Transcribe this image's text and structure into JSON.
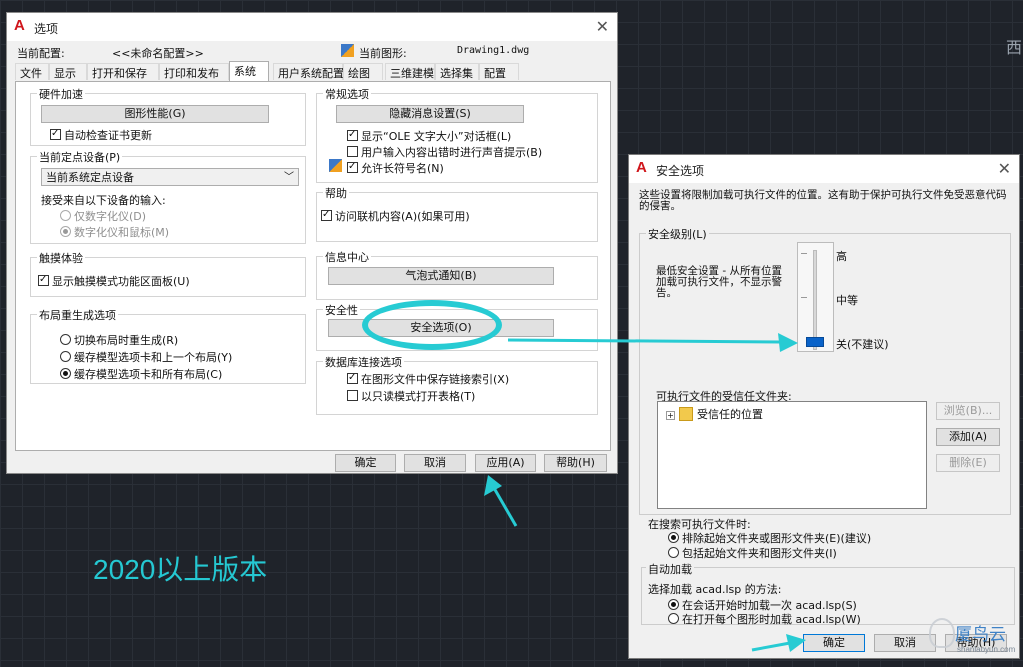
{
  "colors": {
    "accent": "#27cbd3",
    "autocad_red": "#d0161c",
    "slider_blue": "#0a63c9"
  },
  "background": {
    "edge_text": "西"
  },
  "options_dialog": {
    "title": "选项",
    "current_profile_label": "当前配置:",
    "current_profile_value": "<<未命名配置>>",
    "current_drawing_label": "当前图形:",
    "current_drawing_value": "Drawing1.dwg",
    "tabs": [
      "文件",
      "显示",
      "打开和保存",
      "打印和发布",
      "系统",
      "用户系统配置",
      "绘图",
      "三维建模",
      "选择集",
      "配置"
    ],
    "hw_accel": {
      "title": "硬件加速",
      "graphics_button": "图形性能(G)",
      "auto_check_cert": "自动检查证书更新"
    },
    "pointing_device": {
      "title": "当前定点设备(P)",
      "selected": "当前系统定点设备",
      "accept_input_label": "接受来自以下设备的输入:",
      "opt_digitizer_only": "仅数字化仪(D)",
      "opt_digitizer_mouse": "数字化仪和鼠标(M)"
    },
    "touch": {
      "title": "触摸体验",
      "show_touch_panel": "显示触摸模式功能区面板(U)"
    },
    "layout_regen": {
      "title": "布局重生成选项",
      "opt1": "切换布局时重生成(R)",
      "opt2": "缓存模型选项卡和上一个布局(Y)",
      "opt3": "缓存模型选项卡和所有布局(C)"
    },
    "general": {
      "title": "常规选项",
      "hidden_msg_button": "隐藏消息设置(S)",
      "show_ole": "显示“OLE 文字大小”对话框(L)",
      "beep_on_error": "用户输入内容出错时进行声音提示(B)",
      "long_symbol_names": "允许长符号名(N)"
    },
    "help": {
      "title": "帮助",
      "access_online": "访问联机内容(A)(如果可用)"
    },
    "info_center": {
      "title": "信息中心",
      "balloon_button": "气泡式通知(B)"
    },
    "security": {
      "title": "安全性",
      "security_button": "安全选项(O)"
    },
    "db_connect": {
      "title": "数据库连接选项",
      "store_links_index": "在图形文件中保存链接索引(X)",
      "open_readonly": "以只读模式打开表格(T)"
    },
    "buttons": {
      "ok": "确定",
      "cancel": "取消",
      "apply": "应用(A)",
      "help": "帮助(H)"
    }
  },
  "security_dialog": {
    "title": "安全选项",
    "description": "这些设置将限制加载可执行文件的位置。这有助于保护可执行文件免受恶意代码的侵害。",
    "level_group_title": "安全级别(L)",
    "level_desc": "最低安全设置 - 从所有位置加载可执行文件，不显示警告。",
    "level_high": "高",
    "level_medium": "中等",
    "level_off": "关(不建议)",
    "level_value_percent": 0,
    "trusted_label": "可执行文件的受信任文件夹:",
    "trusted_tree_item": "受信任的位置",
    "browse_button": "浏览(B)...",
    "add_button": "添加(A)",
    "delete_button": "删除(E)",
    "search_title": "在搜索可执行文件时:",
    "search_opt1": "排除起始文件夹或图形文件夹(E)(建议)",
    "search_opt2": "包括起始文件夹和图形文件夹(I)",
    "autoload_title": "自动加载",
    "autoload_method_label": "选择加载 acad.lsp 的方法:",
    "autoload_opt1": "在会话开始时加载一次 acad.lsp(S)",
    "autoload_opt2": "在打开每个图形时加载 acad.lsp(W)",
    "ok_button": "确定",
    "cancel_button": "取消",
    "help_button": "帮助(H)"
  },
  "annotation": {
    "caption": "2020以上版本"
  },
  "watermark": {
    "name": "厦鸟云",
    "url": "shanlaoyun.com"
  }
}
